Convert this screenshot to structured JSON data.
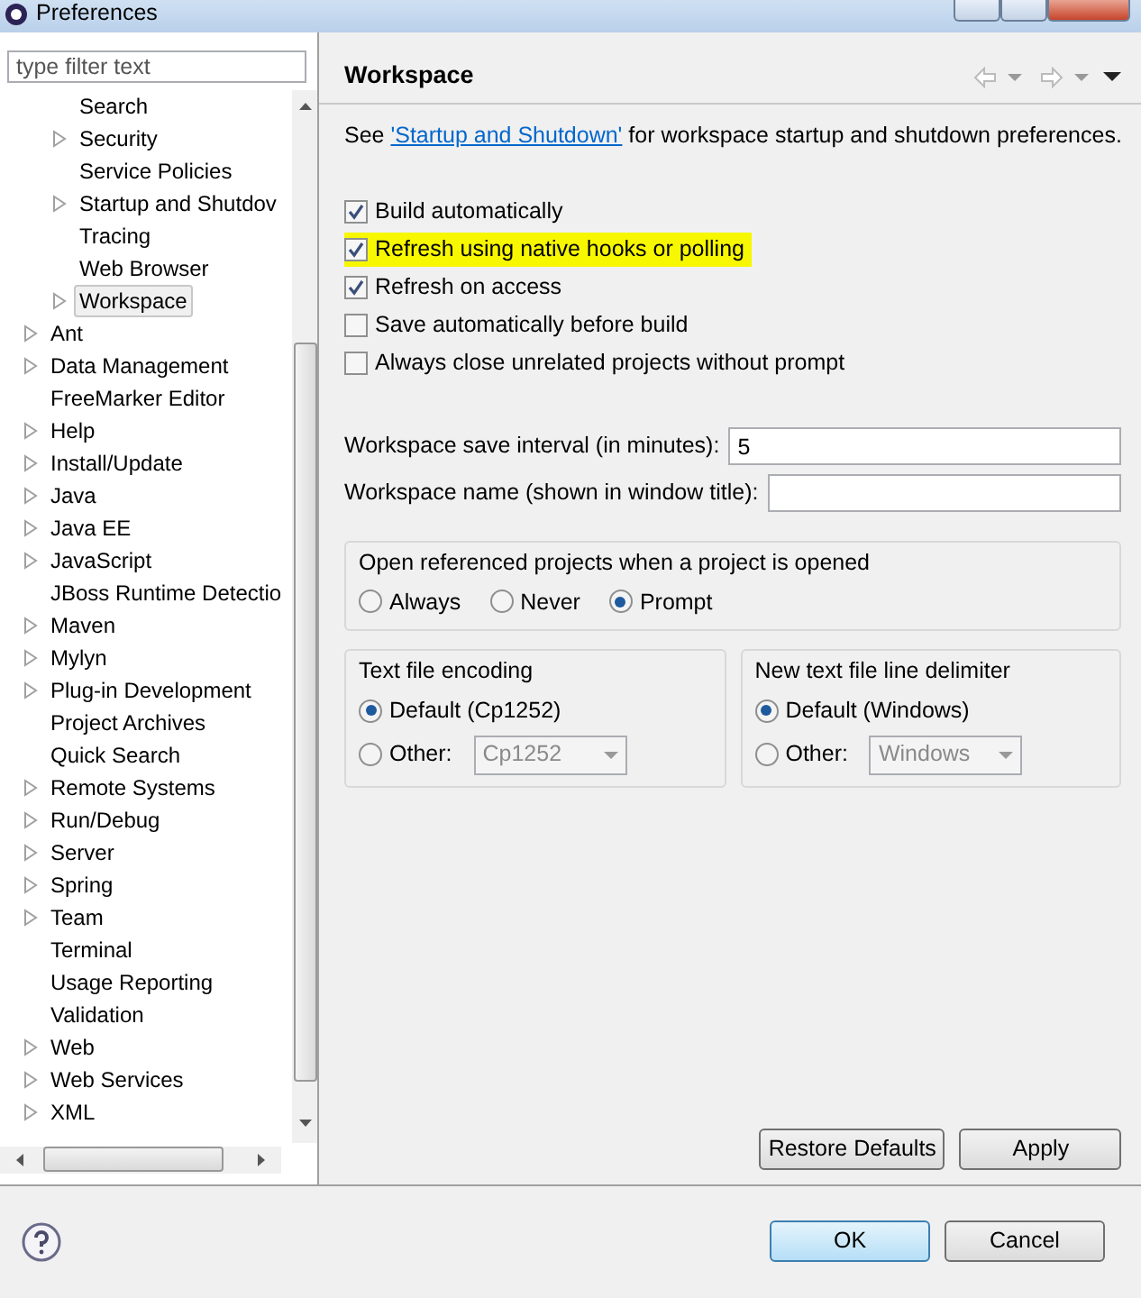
{
  "window": {
    "title": "Preferences"
  },
  "filter": {
    "placeholder": "type filter text"
  },
  "tree": {
    "nested_items": [
      {
        "label": "Search",
        "expandable": false,
        "selected": false
      },
      {
        "label": "Security",
        "expandable": true,
        "selected": false
      },
      {
        "label": "Service Policies",
        "expandable": false,
        "selected": false
      },
      {
        "label": "Startup and Shutdov",
        "expandable": true,
        "selected": false
      },
      {
        "label": "Tracing",
        "expandable": false,
        "selected": false
      },
      {
        "label": "Web Browser",
        "expandable": false,
        "selected": false
      },
      {
        "label": "Workspace",
        "expandable": true,
        "selected": true
      }
    ],
    "items": [
      {
        "label": "Ant",
        "expandable": true,
        "selected": false
      },
      {
        "label": "Data Management",
        "expandable": true,
        "selected": false
      },
      {
        "label": "FreeMarker Editor",
        "expandable": false,
        "selected": false
      },
      {
        "label": "Help",
        "expandable": true,
        "selected": false
      },
      {
        "label": "Install/Update",
        "expandable": true,
        "selected": false
      },
      {
        "label": "Java",
        "expandable": true,
        "selected": false
      },
      {
        "label": "Java EE",
        "expandable": true,
        "selected": false
      },
      {
        "label": "JavaScript",
        "expandable": true,
        "selected": false
      },
      {
        "label": "JBoss Runtime Detectio",
        "expandable": false,
        "selected": false
      },
      {
        "label": "Maven",
        "expandable": true,
        "selected": false
      },
      {
        "label": "Mylyn",
        "expandable": true,
        "selected": false
      },
      {
        "label": "Plug-in Development",
        "expandable": true,
        "selected": false
      },
      {
        "label": "Project Archives",
        "expandable": false,
        "selected": false
      },
      {
        "label": "Quick Search",
        "expandable": false,
        "selected": false
      },
      {
        "label": "Remote Systems",
        "expandable": true,
        "selected": false
      },
      {
        "label": "Run/Debug",
        "expandable": true,
        "selected": false
      },
      {
        "label": "Server",
        "expandable": true,
        "selected": false
      },
      {
        "label": "Spring",
        "expandable": true,
        "selected": false
      },
      {
        "label": "Team",
        "expandable": true,
        "selected": false
      },
      {
        "label": "Terminal",
        "expandable": false,
        "selected": false
      },
      {
        "label": "Usage Reporting",
        "expandable": false,
        "selected": false
      },
      {
        "label": "Validation",
        "expandable": false,
        "selected": false
      },
      {
        "label": "Web",
        "expandable": true,
        "selected": false
      },
      {
        "label": "Web Services",
        "expandable": true,
        "selected": false
      },
      {
        "label": "XML",
        "expandable": true,
        "selected": false
      }
    ]
  },
  "page": {
    "title": "Workspace",
    "description": {
      "before": "See ",
      "link": "'Startup and Shutdown'",
      "after": " for workspace startup and shutdown preferences."
    },
    "checkboxes": [
      {
        "label": "Build automatically",
        "checked": true,
        "highlighted": false
      },
      {
        "label": "Refresh using native hooks or polling",
        "checked": true,
        "highlighted": true
      },
      {
        "label": "Refresh on access",
        "checked": true,
        "highlighted": false
      },
      {
        "label": "Save automatically before build",
        "checked": false,
        "highlighted": false
      },
      {
        "label": "Always close unrelated projects without prompt",
        "checked": false,
        "highlighted": false
      }
    ],
    "fields": [
      {
        "label": "Workspace save interval (in minutes):",
        "value": "5"
      },
      {
        "label": "Workspace name (shown in window title):"
      }
    ],
    "open_group": {
      "title": "Open referenced projects when a project is opened",
      "options": [
        {
          "label": "Always",
          "selected": false
        },
        {
          "label": "Never",
          "selected": false
        },
        {
          "label": "Prompt",
          "selected": true
        }
      ]
    },
    "encoding_groups": [
      {
        "title": "Text file encoding",
        "options": [
          {
            "label": "Default (Cp1252)",
            "selected": true
          },
          {
            "label": "Other:",
            "selected": false
          }
        ],
        "combo": {
          "value": "Cp1252",
          "disabled": true
        }
      },
      {
        "title": "New text file line delimiter",
        "options": [
          {
            "label": "Default (Windows)",
            "selected": true
          },
          {
            "label": "Other:",
            "selected": false
          }
        ],
        "combo": {
          "value": "Windows",
          "disabled": true
        }
      }
    ],
    "buttons": [
      "Restore Defaults",
      "Apply"
    ]
  },
  "dialog_buttons": [
    {
      "label": "OK",
      "default": true
    },
    {
      "label": "Cancel",
      "default": false
    }
  ]
}
